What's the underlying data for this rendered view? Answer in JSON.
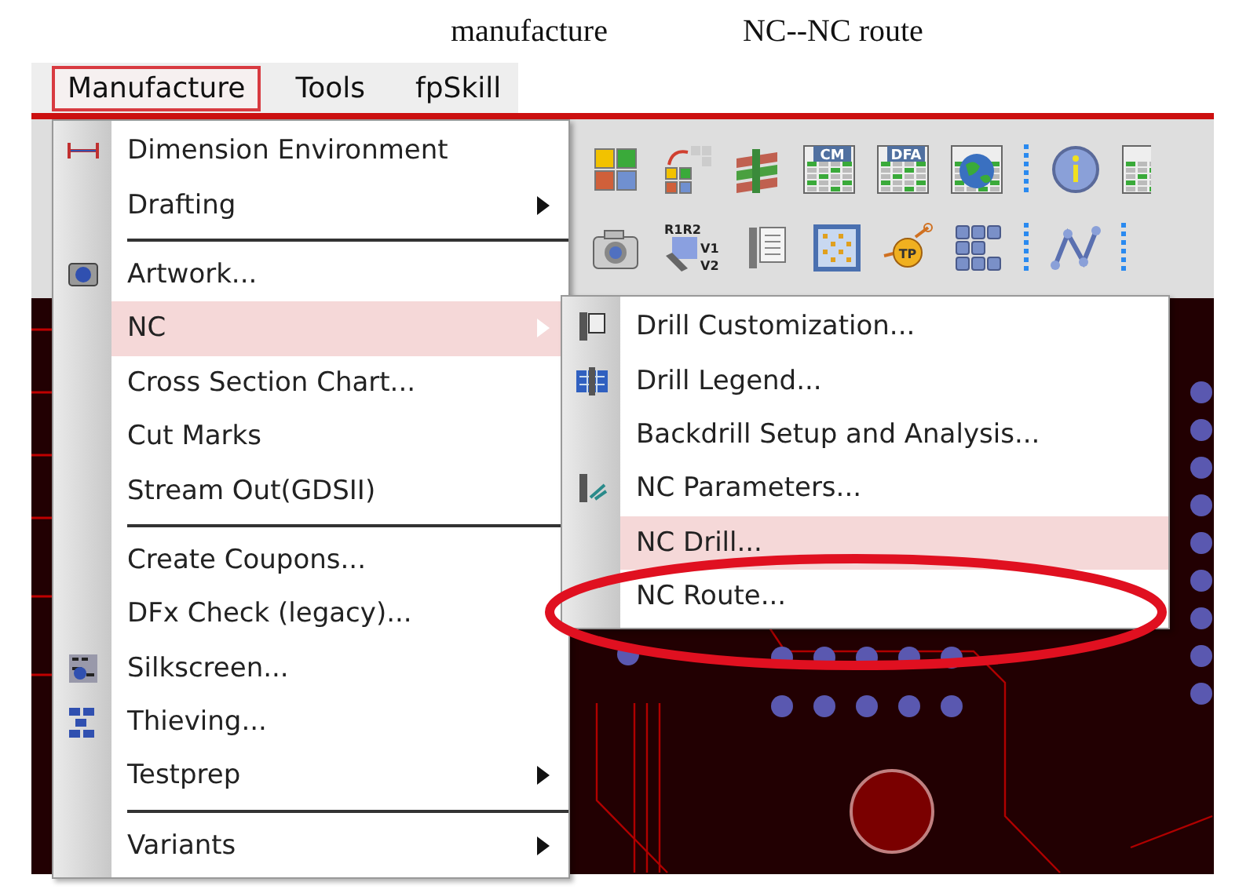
{
  "captions": [
    "manufacture",
    "NC--NC  route"
  ],
  "menubar": [
    {
      "label": "Manufacture",
      "selected": true
    },
    {
      "label": "Tools",
      "selected": false
    },
    {
      "label": "fpSkill",
      "selected": false
    }
  ],
  "toolbars": [
    {
      "items": [
        {
          "kind": "tiles"
        },
        {
          "kind": "tiles-arrow"
        },
        {
          "kind": "layers"
        },
        {
          "kind": "table",
          "label": "CM"
        },
        {
          "kind": "table",
          "label": "DFA"
        },
        {
          "kind": "globe"
        },
        {
          "kind": "grip"
        },
        {
          "kind": "info"
        },
        {
          "kind": "table-partial"
        }
      ]
    },
    {
      "items": [
        {
          "kind": "camera"
        },
        {
          "kind": "wrench-grid",
          "label": "R1R2",
          "label_2": "V1",
          "label_3": "V2"
        },
        {
          "kind": "drill-list"
        },
        {
          "kind": "panel"
        },
        {
          "kind": "probe",
          "label": "TP"
        },
        {
          "kind": "buttons"
        },
        {
          "kind": "grip"
        },
        {
          "kind": "route"
        },
        {
          "kind": "grip"
        }
      ]
    }
  ],
  "menu": {
    "items": [
      {
        "kind": "item",
        "label": "Dimension Environment",
        "submenu": false,
        "selected": false
      },
      {
        "kind": "item",
        "label": "Drafting",
        "submenu": true,
        "selected": false
      },
      {
        "kind": "separator"
      },
      {
        "kind": "item",
        "label": "Artwork...",
        "submenu": false,
        "selected": false
      },
      {
        "kind": "item",
        "label": "NC",
        "submenu": true,
        "selected": true
      },
      {
        "kind": "item",
        "label": "Cross Section Chart...",
        "submenu": false,
        "selected": false
      },
      {
        "kind": "item",
        "label": "Cut Marks",
        "submenu": false,
        "selected": false
      },
      {
        "kind": "item",
        "label": "Stream Out(GDSII)",
        "submenu": false,
        "selected": false
      },
      {
        "kind": "separator"
      },
      {
        "kind": "item",
        "label": "Create Coupons...",
        "submenu": false,
        "selected": false
      },
      {
        "kind": "item",
        "label": "DFx Check (legacy)...",
        "submenu": false,
        "selected": false
      },
      {
        "kind": "item",
        "label": "Silkscreen...",
        "submenu": false,
        "selected": false
      },
      {
        "kind": "item",
        "label": "Thieving...",
        "submenu": false,
        "selected": false
      },
      {
        "kind": "item",
        "label": "Testprep",
        "submenu": true,
        "selected": false
      },
      {
        "kind": "separator"
      },
      {
        "kind": "item",
        "label": "Variants",
        "submenu": true,
        "selected": false
      }
    ]
  },
  "submenu": {
    "items": [
      {
        "kind": "item",
        "label": "Drill Customization...",
        "submenu": false,
        "selected": false
      },
      {
        "kind": "item",
        "label": "Drill Legend...",
        "submenu": false,
        "selected": false
      },
      {
        "kind": "item",
        "label": "Backdrill Setup and Analysis...",
        "submenu": false,
        "selected": false
      },
      {
        "kind": "item",
        "label": "NC Parameters...",
        "submenu": false,
        "selected": false
      },
      {
        "kind": "item",
        "label": "NC Drill...",
        "submenu": false,
        "selected": true
      },
      {
        "kind": "item",
        "label": "NC Route...",
        "submenu": false,
        "selected": false
      }
    ]
  }
}
